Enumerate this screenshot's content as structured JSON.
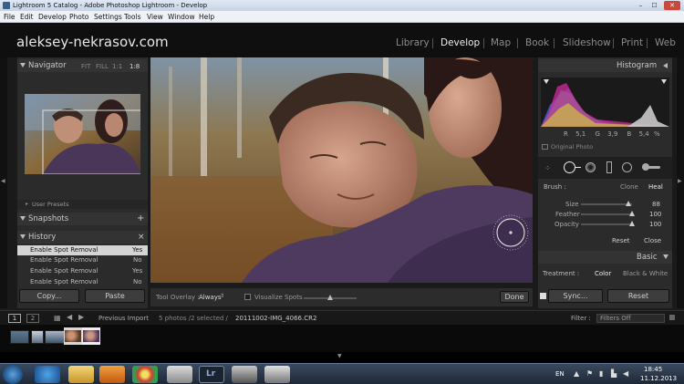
{
  "window": {
    "title": "Lightroom 5 Catalog - Adobe Photoshop Lightroom - Develop",
    "controls": {
      "minimize": "–",
      "maximize": "☐",
      "close": "✕"
    }
  },
  "menu": [
    "File",
    "Edit",
    "Develop",
    "Photo",
    "Settings",
    "Tools",
    "View",
    "Window",
    "Help"
  ],
  "identity_plate": "aleksey-nekrasov.com",
  "modules": [
    "Library",
    "Develop",
    "Map",
    "Book",
    "Slideshow",
    "Print",
    "Web"
  ],
  "navigator": {
    "title": "Navigator",
    "zoom_options": [
      "FIT",
      "FILL",
      "1:1",
      "1:8"
    ]
  },
  "presets": {
    "item": "User Presets"
  },
  "snapshots": {
    "title": "Snapshots",
    "add": "+"
  },
  "history": {
    "title": "History",
    "close": "×",
    "rows": [
      {
        "label": "Enable Spot Removal",
        "value": "Yes"
      },
      {
        "label": "Enable Spot Removal",
        "value": "No"
      },
      {
        "label": "Enable Spot Removal",
        "value": "Yes"
      },
      {
        "label": "Enable Spot Removal",
        "value": "No"
      }
    ]
  },
  "left_buttons": {
    "copy": "Copy...",
    "paste": "Paste"
  },
  "toolbar": {
    "tool_overlay_label": "Tool Overlay :",
    "tool_overlay_value": "Always",
    "visualize_spots": "Visualize Spots",
    "done": "Done"
  },
  "histogram": {
    "title": "Histogram",
    "readout": {
      "r_label": "R",
      "r": "5,1",
      "g_label": "G",
      "g": "3,9",
      "b_label": "B",
      "b": "5,4",
      "unit": "%"
    },
    "original_photo": "Original Photo"
  },
  "spot_removal": {
    "brush_label": "Brush :",
    "clone": "Clone",
    "heal": "Heal",
    "sliders": [
      {
        "label": "Size",
        "value": "88",
        "level": 0.88
      },
      {
        "label": "Feather",
        "value": "100",
        "level": 1.0
      },
      {
        "label": "Opacity",
        "value": "100",
        "level": 1.0
      }
    ],
    "reset": "Reset",
    "close": "Close"
  },
  "basic": {
    "title": "Basic",
    "treatment_label": "Treatment :",
    "color": "Color",
    "bw": "Black & White"
  },
  "right_buttons": {
    "sync": "Sync...",
    "reset": "Reset"
  },
  "filmbar": {
    "screen1": "1",
    "screen2": "2",
    "source": "Previous Import",
    "count": "5 photos /2 selected /",
    "filename": "20111002-IMG_4066.CR2",
    "filter_label": "Filter :",
    "filter_value": "Filters Off"
  },
  "taskbar": {
    "lang": "EN",
    "time": "18:45",
    "date": "11.12.2013",
    "lr_label": "Lr"
  },
  "colors": {
    "panel": "#2b2b2b",
    "header": "#333333",
    "accent_selected": "#d8d8d8"
  }
}
